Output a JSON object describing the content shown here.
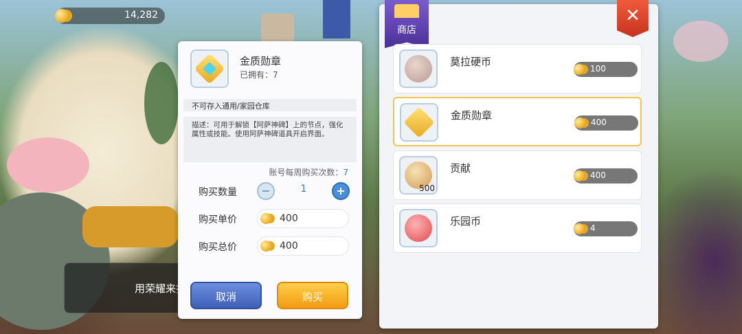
{
  "currency": {
    "icon": "gold-coin-icon",
    "amount": "14,282"
  },
  "toast": {
    "text": "用荣耀来打"
  },
  "detail": {
    "item_name": "金质勋章",
    "owned_label": "已拥有：",
    "owned_value": "7",
    "storage_note": "不可存入通用/家园仓库",
    "description": "描述：可用于解锁【阿萨神碑】上的节点，强化属性或技能。使用阿萨神碑道具开启界面。",
    "weekly_label": "账号每周购买次数：",
    "weekly_value": "7",
    "qty_label": "购买数量",
    "qty_value": "1",
    "unit_label": "购买单价",
    "unit_price": "400",
    "total_label": "购买总价",
    "total_price": "400",
    "cancel_label": "取消",
    "buy_label": "购买"
  },
  "shop": {
    "title": "商店",
    "close_label": "✕",
    "items": [
      {
        "name": "莫拉硬币",
        "price": "100",
        "icon": "mora-coin-icon",
        "tag": ""
      },
      {
        "name": "金质勋章",
        "price": "400",
        "icon": "gold-medal-icon",
        "tag": ""
      },
      {
        "name": "贡献",
        "price": "400",
        "icon": "contribution-medal-icon",
        "tag": "500"
      },
      {
        "name": "乐园币",
        "price": "4",
        "icon": "park-coin-icon",
        "tag": ""
      }
    ]
  },
  "colors": {
    "accent_blue": "#3a7cc3",
    "buy_orange": "#f29b12",
    "cancel_blue": "#3e5fb7",
    "selected_border": "#f2c34a",
    "close_red": "#c7321e"
  }
}
